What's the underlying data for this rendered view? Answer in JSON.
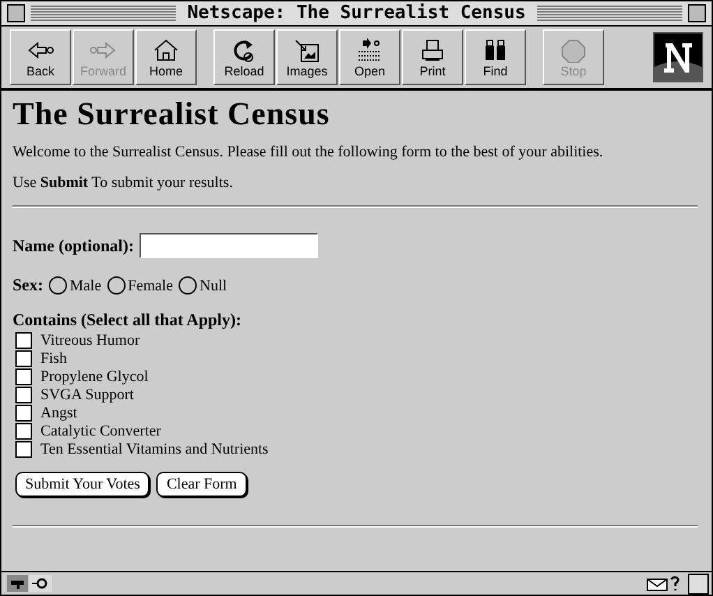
{
  "window": {
    "title": "Netscape: The Surrealist Census"
  },
  "toolbar": {
    "groups": [
      [
        {
          "label": "Back",
          "disabled": false
        },
        {
          "label": "Forward",
          "disabled": true
        },
        {
          "label": "Home",
          "disabled": false
        }
      ],
      [
        {
          "label": "Reload",
          "disabled": false
        },
        {
          "label": "Images",
          "disabled": false
        },
        {
          "label": "Open",
          "disabled": false
        },
        {
          "label": "Print",
          "disabled": false
        },
        {
          "label": "Find",
          "disabled": false
        }
      ],
      [
        {
          "label": "Stop",
          "disabled": true
        }
      ]
    ]
  },
  "page": {
    "heading": "The Surrealist Census",
    "intro": "Welcome to the Surrealist Census. Please fill out the following form to the best of your abilities.",
    "instruction": "Use **Submit** To submit your results.",
    "name_field": {
      "label": "Name (optional):"
    },
    "sex": {
      "label": "Sex:",
      "options": [
        {
          "label": "Male",
          "selected": false
        },
        {
          "label": "Female",
          "selected": false
        },
        {
          "label": "Null",
          "selected": false
        }
      ]
    },
    "contains": {
      "label": "Contains (Select all that Apply):",
      "options": [
        {
          "label": "Vitreous Humor",
          "checked": false
        },
        {
          "label": "Fish",
          "checked": false
        },
        {
          "label": "Propylene Glycol",
          "checked": false
        },
        {
          "label": "SVGA Support",
          "checked": false
        },
        {
          "label": "Angst",
          "checked": false
        },
        {
          "label": "Catalytic Converter",
          "checked": false
        },
        {
          "label": "Ten Essential Vitamins and Nutrients",
          "checked": false
        }
      ]
    },
    "buttons": [
      "Submit Your Votes",
      "Clear Form"
    ]
  }
}
